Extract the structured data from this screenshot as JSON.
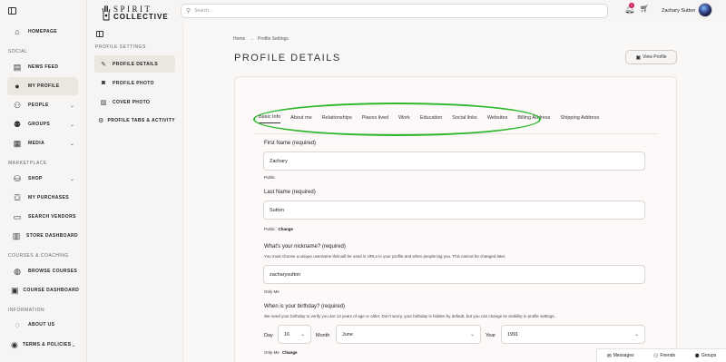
{
  "sidebar": {
    "items": [
      {
        "label": "Homepage",
        "icon": "home-icon",
        "glyph": "⌂"
      },
      {
        "label": "News Feed",
        "icon": "newsfeed-icon",
        "glyph": "▤"
      },
      {
        "label": "My Profile",
        "icon": "user-icon",
        "glyph": "●"
      },
      {
        "label": "People",
        "icon": "people-icon",
        "glyph": "⚇"
      },
      {
        "label": "Groups",
        "icon": "groups-icon",
        "glyph": "⚉"
      },
      {
        "label": "Media",
        "icon": "media-icon",
        "glyph": "▦"
      },
      {
        "label": "Shop",
        "icon": "shop-icon",
        "glyph": "⛁"
      },
      {
        "label": "My Purchases",
        "icon": "purchases-icon",
        "glyph": "⛋"
      },
      {
        "label": "Search Vendors",
        "icon": "vendors-icon",
        "glyph": "▭"
      },
      {
        "label": "Store Dashboard",
        "icon": "dashboard-icon",
        "glyph": "▥"
      },
      {
        "label": "Browse Courses",
        "icon": "courses-icon",
        "glyph": "◍"
      },
      {
        "label": "Course Dashboard",
        "icon": "course-dashboard-icon",
        "glyph": "▣"
      },
      {
        "label": "About Us",
        "icon": "about-icon",
        "glyph": "◌"
      },
      {
        "label": "Terms & Policies",
        "icon": "terms-icon",
        "glyph": "◉"
      }
    ],
    "sections": [
      "Social",
      "Marketplace",
      "Courses & Coaching",
      "Information"
    ]
  },
  "header": {
    "logo_line1": "SPIRIT",
    "logo_line2": "COLLECTIVE",
    "search_placeholder": "Search...",
    "notification_count": "1",
    "user_name": "Zachary Sutton"
  },
  "settings_nav": {
    "heading": "Profile Settings",
    "items": [
      {
        "label": "Profile Details",
        "icon": "edit-icon",
        "glyph": "✎"
      },
      {
        "label": "Profile Photo",
        "icon": "camera-icon",
        "glyph": "◙"
      },
      {
        "label": "Cover Photo",
        "icon": "image-icon",
        "glyph": "▨"
      },
      {
        "label": "Profile Tabs & Activity",
        "icon": "tabs-icon",
        "glyph": "⚙"
      }
    ]
  },
  "main": {
    "breadcrumb": [
      "Home",
      "→",
      "Profile Settings"
    ],
    "title": "Profile Details",
    "view_profile_label": "View Profile",
    "tabs": [
      "Basic Info",
      "About me",
      "Relationships",
      "Places lived",
      "Work",
      "Education",
      "Social links",
      "Websites",
      "Billing Address",
      "Shipping Address"
    ],
    "fields": {
      "first_name_label": "First Name (required)",
      "first_name_value": "Zachary",
      "first_name_visibility": "Public",
      "last_name_label": "Last Name (required)",
      "last_name_value": "Sutton",
      "last_name_visibility": "Public",
      "change_label": "Change",
      "nickname_label": "What's your nickname? (required)",
      "nickname_desc": "You must choose a unique username that will be used in URLs to your profile and when people tag you. This cannot be changed later.",
      "nickname_value": "zacharysutton",
      "nickname_visibility": "Only Me",
      "birthday_label": "When is your birthday? (required)",
      "birthday_desc": "We need your birthday to verify you are 13 years of age or older. Don't worry, your birthday is hidden by default, but you can change its visibility in profile settings.",
      "day_label": "Day",
      "day_value": "16",
      "month_label": "Month",
      "month_value": "June",
      "year_label": "Year",
      "year_value": "1991",
      "birthday_visibility": "Only Me"
    }
  },
  "bottom_bar": {
    "messages": "Messages",
    "friends": "Friends",
    "groups": "Groups"
  },
  "colors": {
    "highlight_oval": "#2eb82e",
    "notification_badge": "#d81b60",
    "active_item_bg": "#ece6e1"
  }
}
